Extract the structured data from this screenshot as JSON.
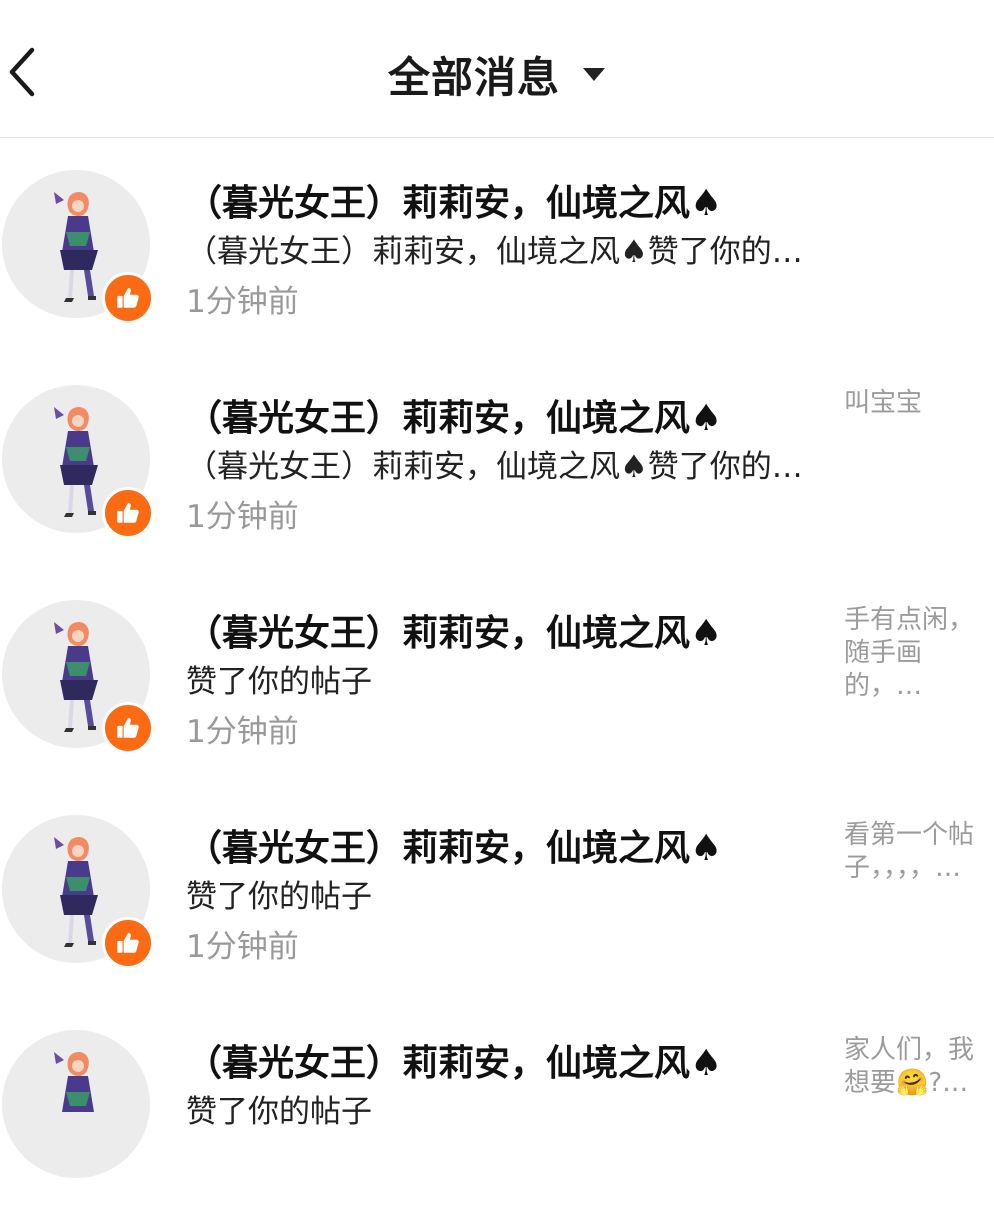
{
  "header": {
    "title": "全部消息"
  },
  "messages": [
    {
      "name": "（暮光女王）莉莉安，仙境之风♠",
      "action": "（暮光女王）莉莉安，仙境之风♠赞了你的…",
      "time": "1分钟前",
      "snippet": ""
    },
    {
      "name": "（暮光女王）莉莉安，仙境之风♠",
      "action": "（暮光女王）莉莉安，仙境之风♠赞了你的…",
      "time": "1分钟前",
      "snippet": "叫宝宝"
    },
    {
      "name": "（暮光女王）莉莉安，仙境之风♠",
      "action": "赞了你的帖子",
      "time": "1分钟前",
      "snippet": "手有点闲，随手画的，…"
    },
    {
      "name": "（暮光女王）莉莉安，仙境之风♠",
      "action": "赞了你的帖子",
      "time": "1分钟前",
      "snippet": "看第一个帖子，，，，…"
    },
    {
      "name": "（暮光女王）莉莉安，仙境之风♠",
      "action": "赞了你的帖子",
      "time": "",
      "snippet": "家人们，我想要🤗?…"
    }
  ],
  "icons": {
    "back": "chevron-left-icon",
    "dropdown": "caret-down-icon",
    "like": "thumbs-up-icon",
    "avatar": "anime-character-avatar"
  },
  "colors": {
    "like_badge": "#fa6b13",
    "avatar_bg": "#ececec",
    "time_text": "#999999",
    "snippet_text": "#9b9b9b"
  }
}
